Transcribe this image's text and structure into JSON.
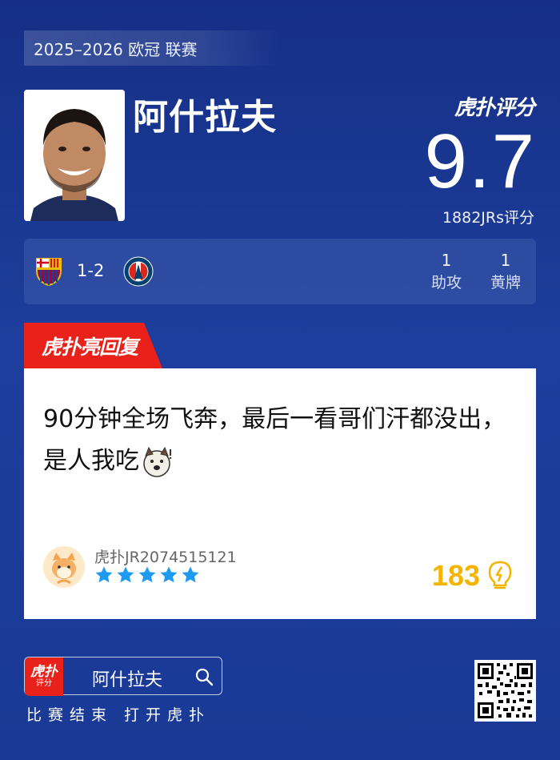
{
  "league": "2025–2026 欧冠 联赛",
  "player": {
    "name": "阿什拉夫"
  },
  "brand": {
    "logo_text": "虎扑评分"
  },
  "rating": {
    "score": "9.7",
    "count_label": "1882JRs评分"
  },
  "match": {
    "score": "1-2",
    "home_crest_icon": "barcelona-crest-icon",
    "away_crest_icon": "psg-crest-icon",
    "stats": [
      {
        "value": "1",
        "label": "助攻"
      },
      {
        "value": "1",
        "label": "黄牌"
      }
    ]
  },
  "reply": {
    "tab_label": "虎扑亮回复",
    "text": "90分钟全场飞奔，最后一看哥们汗都没出，是人我吃",
    "user": "虎扑JR2074515121",
    "stars": 5,
    "likes": "183"
  },
  "footer": {
    "app_icon_top": "虎扑",
    "app_icon_bottom": "评分",
    "search_text": "阿什拉夫",
    "cta": "比赛结束 打开虎扑"
  },
  "colors": {
    "background": "#1a3996",
    "accent_red": "#e8211b",
    "likes_gold": "#f5b400",
    "star_blue": "#1e9bf0"
  }
}
